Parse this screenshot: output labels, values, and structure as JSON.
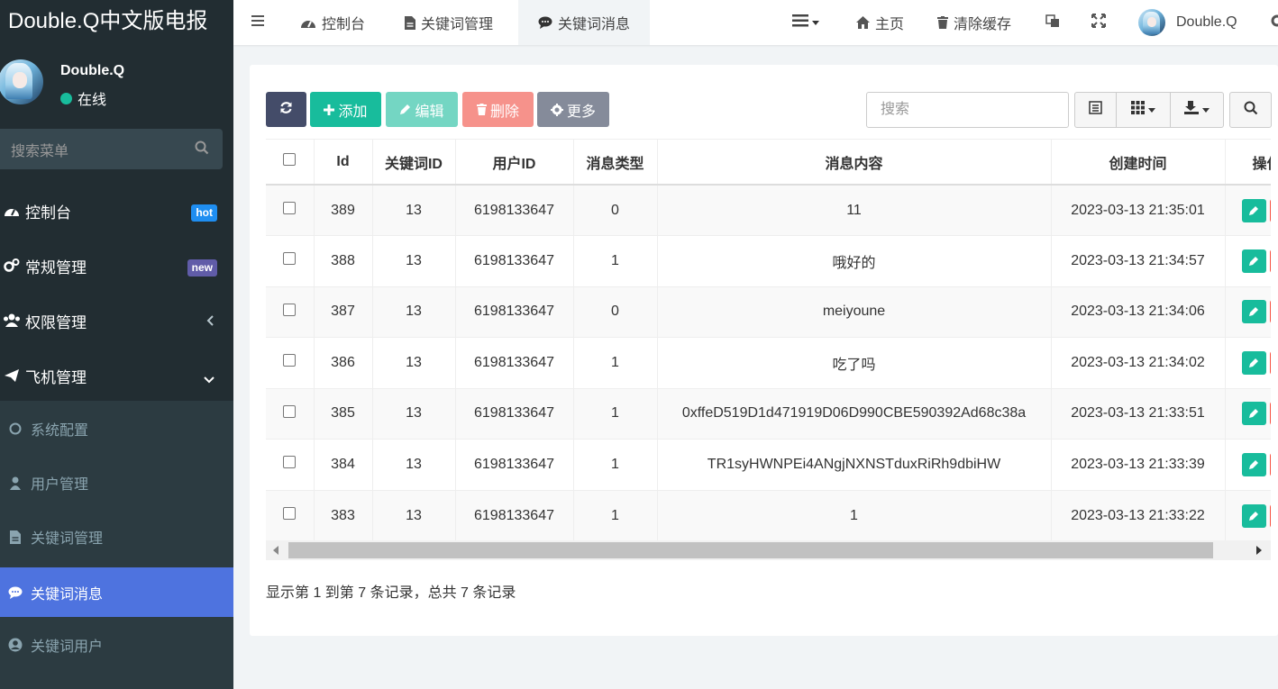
{
  "app": {
    "logo": "Double.Q中文版电报"
  },
  "user": {
    "name": "Double.Q",
    "status": "在线"
  },
  "sidebar": {
    "search_placeholder": "搜索菜单",
    "items": [
      {
        "label": "控制台",
        "icon": "dashboard-icon",
        "badge": "hot",
        "badge_color": "#1f8ef1"
      },
      {
        "label": "常规管理",
        "icon": "cogs-icon",
        "badge": "new",
        "badge_color": "#605ca8"
      },
      {
        "label": "权限管理",
        "icon": "users-icon"
      },
      {
        "label": "飞机管理",
        "icon": "paper-plane-icon"
      }
    ],
    "subitems": [
      {
        "label": "系统配置",
        "icon": "circle-icon"
      },
      {
        "label": "用户管理",
        "icon": "user-icon"
      },
      {
        "label": "关键词管理",
        "icon": "file-icon"
      },
      {
        "label": "关键词消息",
        "icon": "comment-icon",
        "active": true
      },
      {
        "label": "关键词用户",
        "icon": "user-circle-icon"
      }
    ]
  },
  "topbar": {
    "tabs": [
      {
        "label": "控制台",
        "icon": "dashboard-icon"
      },
      {
        "label": "关键词管理",
        "icon": "file-icon"
      },
      {
        "label": "关键词消息",
        "icon": "comment-icon",
        "active": true
      }
    ],
    "home": "主页",
    "clear_cache": "清除缓存",
    "username": "Double.Q"
  },
  "toolbar": {
    "add": "添加",
    "edit": "编辑",
    "delete": "删除",
    "more": "更多",
    "search_placeholder": "搜索"
  },
  "table": {
    "columns": [
      "Id",
      "关键词ID",
      "用户ID",
      "消息类型",
      "消息内容",
      "创建时间",
      "操作"
    ],
    "rows": [
      [
        "389",
        "13",
        "6198133647",
        "0",
        "11",
        "2023-03-13 21:35:01"
      ],
      [
        "388",
        "13",
        "6198133647",
        "1",
        "哦好的",
        "2023-03-13 21:34:57"
      ],
      [
        "387",
        "13",
        "6198133647",
        "0",
        "meiyoune",
        "2023-03-13 21:34:06"
      ],
      [
        "386",
        "13",
        "6198133647",
        "1",
        "吃了吗",
        "2023-03-13 21:34:02"
      ],
      [
        "385",
        "13",
        "6198133647",
        "1",
        "0xffeD519D1d471919D06D990CBE590392Ad68c38a",
        "2023-03-13 21:33:51"
      ],
      [
        "384",
        "13",
        "6198133647",
        "1",
        "TR1syHWNPEi4ANgjNXNSTduxRiRh9dbiHW",
        "2023-03-13 21:33:39"
      ],
      [
        "383",
        "13",
        "6198133647",
        "1",
        "1",
        "2023-03-13 21:33:22"
      ]
    ]
  },
  "pagination": {
    "info": "显示第 1 到第 7 条记录，总共 7 条记录"
  },
  "colors": {
    "sidebar_bg": "#222d32",
    "submenu_bg": "#2c3b41",
    "active_menu": "#4e73df",
    "btn_refresh": "#444c69",
    "btn_add": "#18bc9c",
    "btn_edit": "#74d6c3",
    "btn_delete": "#f6928b",
    "btn_more": "#858b9a"
  }
}
